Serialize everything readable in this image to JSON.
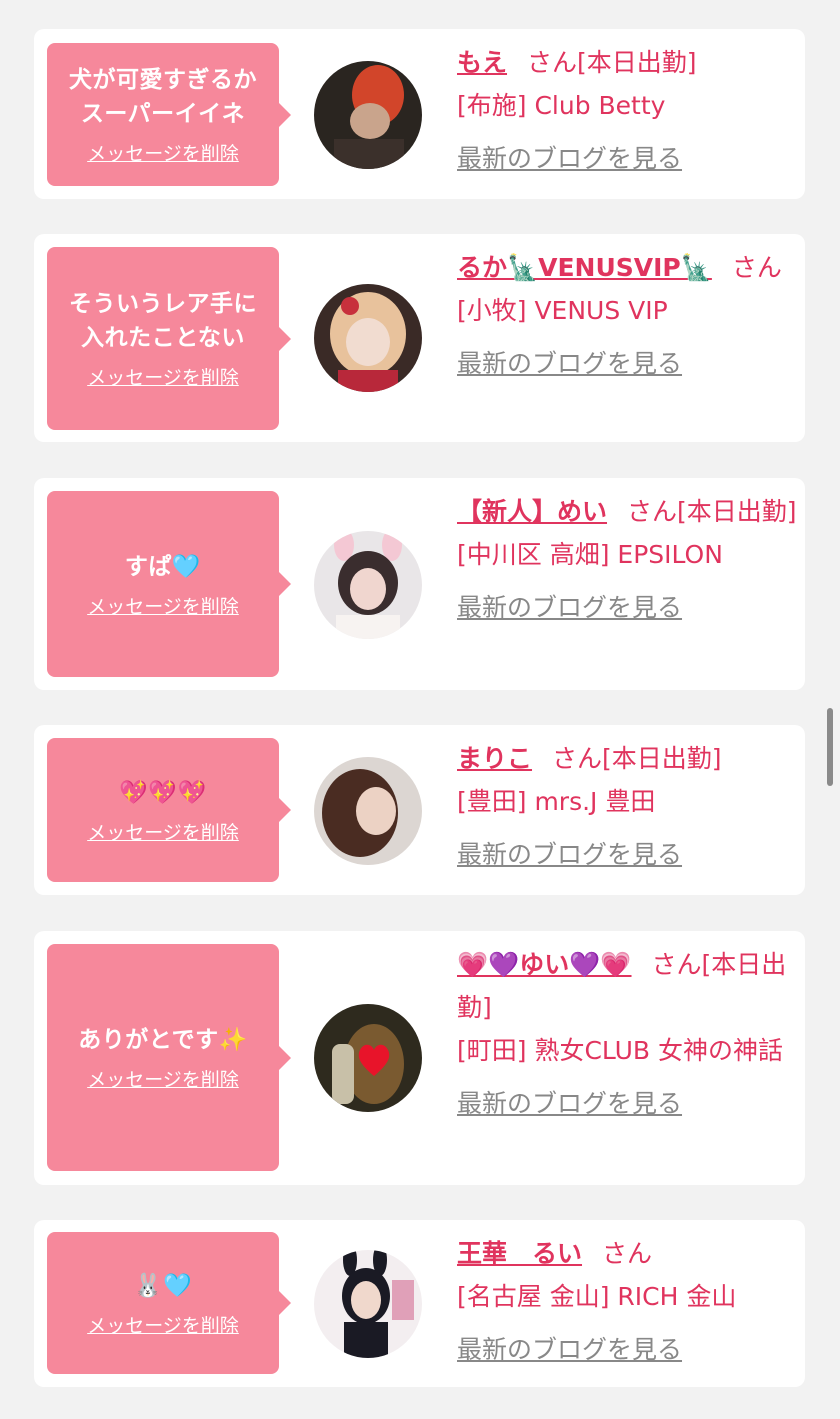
{
  "delete_label": "メッセージを削除",
  "blog_label": "最新のブログを見る",
  "san_label": "さん",
  "messages": [
    {
      "bubble_text": "犬が可愛すぎるかスーパーイイネ",
      "name": "もえ",
      "status": "[本日出勤]",
      "shop": "[布施] Club Betty"
    },
    {
      "bubble_text": "そういうレア手に入れたことない",
      "name": "るか🗽VENUSVIP🗽",
      "status": "",
      "shop": "[小牧] VENUS VIP"
    },
    {
      "bubble_text": "すぱ🩵",
      "name": "【新人】めい",
      "status": "[本日出勤]",
      "shop": "[中川区 高畑] EPSILON"
    },
    {
      "bubble_text": "💖💖💖",
      "name": "まりこ",
      "status": "[本日出勤]",
      "shop": "[豊田] mrs.J 豊田"
    },
    {
      "bubble_text": "ありがとです✨",
      "name": "💗💜ゆい💜💗",
      "status": "[本日出勤]",
      "shop": "[町田] 熟女CLUB 女神の神話"
    },
    {
      "bubble_text": "🐰🩵",
      "name": "王華　るい",
      "status": "",
      "shop": "[名古屋 金山] RICH 金山"
    }
  ],
  "avatars": [
    {
      "icon": "avatar-red-hair-photo",
      "colors": [
        "#2a2520",
        "#d2452a",
        "#c9a48c"
      ]
    },
    {
      "icon": "avatar-blonde-kimono-photo",
      "colors": [
        "#3a2a26",
        "#e8c29c",
        "#f1dcd0"
      ]
    },
    {
      "icon": "avatar-bunny-ears-photo",
      "colors": [
        "#e9e6e8",
        "#3a2d2e",
        "#f0d6cf"
      ]
    },
    {
      "icon": "avatar-dark-hair-photo",
      "colors": [
        "#dcd6d2",
        "#4a2c22",
        "#ecd2c4"
      ]
    },
    {
      "icon": "avatar-heart-covered-photo",
      "colors": [
        "#2e2a1e",
        "#7a5a30",
        "#e8142a"
      ]
    },
    {
      "icon": "avatar-bunny-suit-photo",
      "colors": [
        "#f3eef0",
        "#1a1a24",
        "#f0d8cc"
      ]
    }
  ]
}
